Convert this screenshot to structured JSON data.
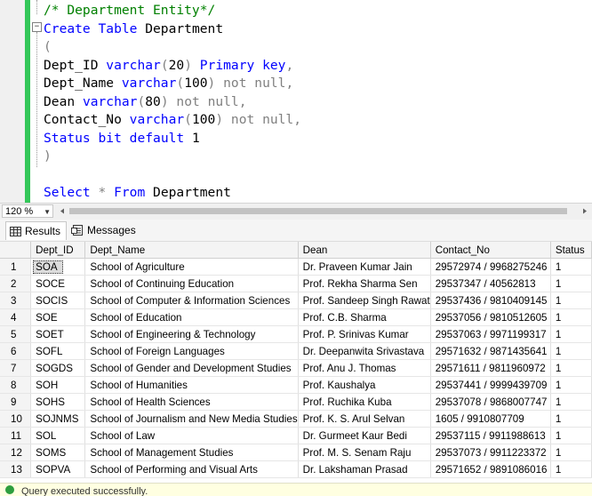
{
  "editor": {
    "lines": [
      [
        {
          "t": "/* Department Entity*/",
          "c": "cm"
        }
      ],
      [
        {
          "t": "Create",
          "c": "kw"
        },
        {
          "t": " ",
          "c": "tx"
        },
        {
          "t": "Table",
          "c": "kw"
        },
        {
          "t": " Department",
          "c": "tx"
        }
      ],
      [
        {
          "t": "(",
          "c": "gr"
        }
      ],
      [
        {
          "t": "Dept_ID ",
          "c": "tx"
        },
        {
          "t": "varchar",
          "c": "kw"
        },
        {
          "t": "(",
          "c": "gr"
        },
        {
          "t": "20",
          "c": "tx"
        },
        {
          "t": ")",
          "c": "gr"
        },
        {
          "t": " ",
          "c": "tx"
        },
        {
          "t": "Primary",
          "c": "kw"
        },
        {
          "t": " ",
          "c": "tx"
        },
        {
          "t": "key",
          "c": "kw"
        },
        {
          "t": ",",
          "c": "gr"
        }
      ],
      [
        {
          "t": "Dept_Name ",
          "c": "tx"
        },
        {
          "t": "varchar",
          "c": "kw"
        },
        {
          "t": "(",
          "c": "gr"
        },
        {
          "t": "100",
          "c": "tx"
        },
        {
          "t": ")",
          "c": "gr"
        },
        {
          "t": " ",
          "c": "tx"
        },
        {
          "t": "not",
          "c": "gr"
        },
        {
          "t": " ",
          "c": "tx"
        },
        {
          "t": "null",
          "c": "gr"
        },
        {
          "t": ",",
          "c": "gr"
        }
      ],
      [
        {
          "t": "Dean ",
          "c": "tx"
        },
        {
          "t": "varchar",
          "c": "kw"
        },
        {
          "t": "(",
          "c": "gr"
        },
        {
          "t": "80",
          "c": "tx"
        },
        {
          "t": ")",
          "c": "gr"
        },
        {
          "t": " ",
          "c": "tx"
        },
        {
          "t": "not",
          "c": "gr"
        },
        {
          "t": " ",
          "c": "tx"
        },
        {
          "t": "null",
          "c": "gr"
        },
        {
          "t": ",",
          "c": "gr"
        }
      ],
      [
        {
          "t": "Contact_No ",
          "c": "tx"
        },
        {
          "t": "varchar",
          "c": "kw"
        },
        {
          "t": "(",
          "c": "gr"
        },
        {
          "t": "100",
          "c": "tx"
        },
        {
          "t": ")",
          "c": "gr"
        },
        {
          "t": " ",
          "c": "tx"
        },
        {
          "t": "not",
          "c": "gr"
        },
        {
          "t": " ",
          "c": "tx"
        },
        {
          "t": "null",
          "c": "gr"
        },
        {
          "t": ",",
          "c": "gr"
        }
      ],
      [
        {
          "t": "Status",
          "c": "kw"
        },
        {
          "t": " ",
          "c": "tx"
        },
        {
          "t": "bit",
          "c": "kw"
        },
        {
          "t": " ",
          "c": "tx"
        },
        {
          "t": "default",
          "c": "kw"
        },
        {
          "t": " 1",
          "c": "tx"
        }
      ],
      [
        {
          "t": ")",
          "c": "gr"
        }
      ],
      [
        {
          "t": "",
          "c": "tx"
        }
      ],
      [
        {
          "t": "Select",
          "c": "kw"
        },
        {
          "t": " ",
          "c": "tx"
        },
        {
          "t": "*",
          "c": "gr"
        },
        {
          "t": " ",
          "c": "tx"
        },
        {
          "t": "From",
          "c": "kw"
        },
        {
          "t": " Department",
          "c": "tx"
        }
      ]
    ]
  },
  "zoom": {
    "value": "120 %"
  },
  "tabs": {
    "results": "Results",
    "messages": "Messages"
  },
  "grid": {
    "columns": [
      "Dept_ID",
      "Dept_Name",
      "Dean",
      "Contact_No",
      "Status"
    ],
    "rows": [
      [
        "1",
        "SOA",
        "School of Agriculture",
        "Dr. Praveen Kumar Jain",
        "29572974 / 9968275246",
        "1"
      ],
      [
        "2",
        "SOCE",
        "School of Continuing Education",
        "Prof. Rekha Sharma Sen",
        "29537347 / 40562813",
        "1"
      ],
      [
        "3",
        "SOCIS",
        "School of Computer & Information Sciences",
        "Prof. Sandeep Singh Rawat",
        "29537436 / 9810409145",
        "1"
      ],
      [
        "4",
        "SOE",
        "School of Education",
        "Prof. C.B. Sharma",
        "29537056 / 9810512605",
        "1"
      ],
      [
        "5",
        "SOET",
        "School of Engineering & Technology",
        "Prof. P. Srinivas Kumar",
        "29537063 / 9971199317",
        "1"
      ],
      [
        "6",
        "SOFL",
        "School of Foreign Languages",
        "Dr. Deepanwita Srivastava",
        "29571632 / 9871435641",
        "1"
      ],
      [
        "7",
        "SOGDS",
        "School of Gender and Development Studies",
        "Prof. Anu J. Thomas",
        "29571611 / 9811960972",
        "1"
      ],
      [
        "8",
        "SOH",
        "School of Humanities",
        "Prof. Kaushalya",
        "29537441 / 9999439709",
        "1"
      ],
      [
        "9",
        "SOHS",
        "School of Health Sciences",
        "Prof. Ruchika Kuba",
        "29537078 / 9868007747",
        "1"
      ],
      [
        "10",
        "SOJNMS",
        "School of Journalism and New Media Studies",
        "Prof. K. S. Arul Selvan",
        "1605 / 9910807709",
        "1"
      ],
      [
        "11",
        "SOL",
        "School of Law",
        "Dr. Gurmeet Kaur Bedi",
        "29537115 / 9911988613",
        "1"
      ],
      [
        "12",
        "SOMS",
        "School of Management Studies",
        "Prof. M. S. Senam Raju",
        "29537073 / 9911223372",
        "1"
      ],
      [
        "13",
        "SOPVA",
        "School of Performing and Visual Arts",
        "Dr. Lakshaman Prasad",
        "29571652 / 9891086016",
        "1"
      ]
    ]
  },
  "status": {
    "text": "Query executed successfully."
  },
  "colors": {
    "keyword": "#0000ff",
    "comment": "#008000",
    "operator": "#808080",
    "change_bar": "#34c759"
  },
  "icons": {
    "fold": "minus-box-icon",
    "results": "grid-icon",
    "messages": "messages-icon",
    "status": "success-icon"
  }
}
